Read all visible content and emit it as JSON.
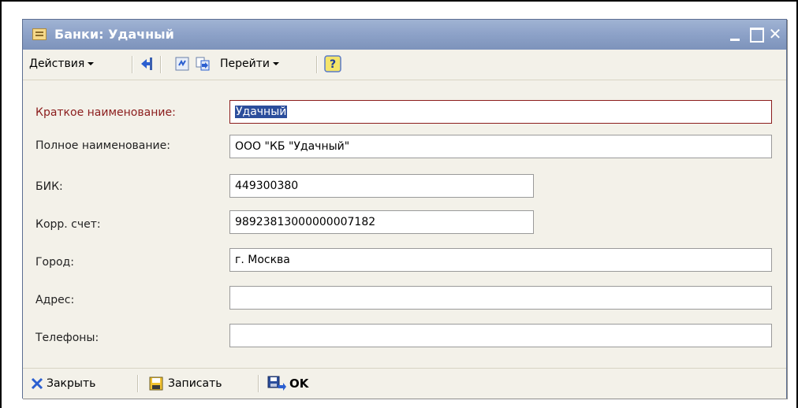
{
  "window": {
    "title": "Банки: Удачный",
    "controls": {
      "minimize": "minimize",
      "maximize": "maximize",
      "close": "close"
    }
  },
  "toolbar": {
    "actions_label": "Действия",
    "goto_label": "Перейти",
    "icons": [
      "back-arrow-icon",
      "refresh-icon",
      "copy-icon",
      "help-icon"
    ],
    "help_glyph": "?"
  },
  "form": {
    "short_name": {
      "label": "Краткое наименование:",
      "value": "Удачный"
    },
    "full_name": {
      "label": "Полное наименование:",
      "value": "ООО \"КБ \"Удачный\""
    },
    "bik": {
      "label": "БИК:",
      "value": "449300380"
    },
    "corr_account": {
      "label": "Корр. счет:",
      "value": "98923813000000007182"
    },
    "city": {
      "label": "Город:",
      "value": "г. Москва"
    },
    "address": {
      "label": "Адрес:",
      "value": ""
    },
    "phones": {
      "label": "Телефоны:",
      "value": ""
    }
  },
  "bottombar": {
    "close_label": "Закрыть",
    "save_label": "Записать",
    "ok_label": "OK"
  },
  "colors": {
    "titlebar": "#8ea3c9",
    "window_bg": "#f3f1e9",
    "active_label": "#8b1c1c",
    "selection": "#2b4e9c"
  }
}
